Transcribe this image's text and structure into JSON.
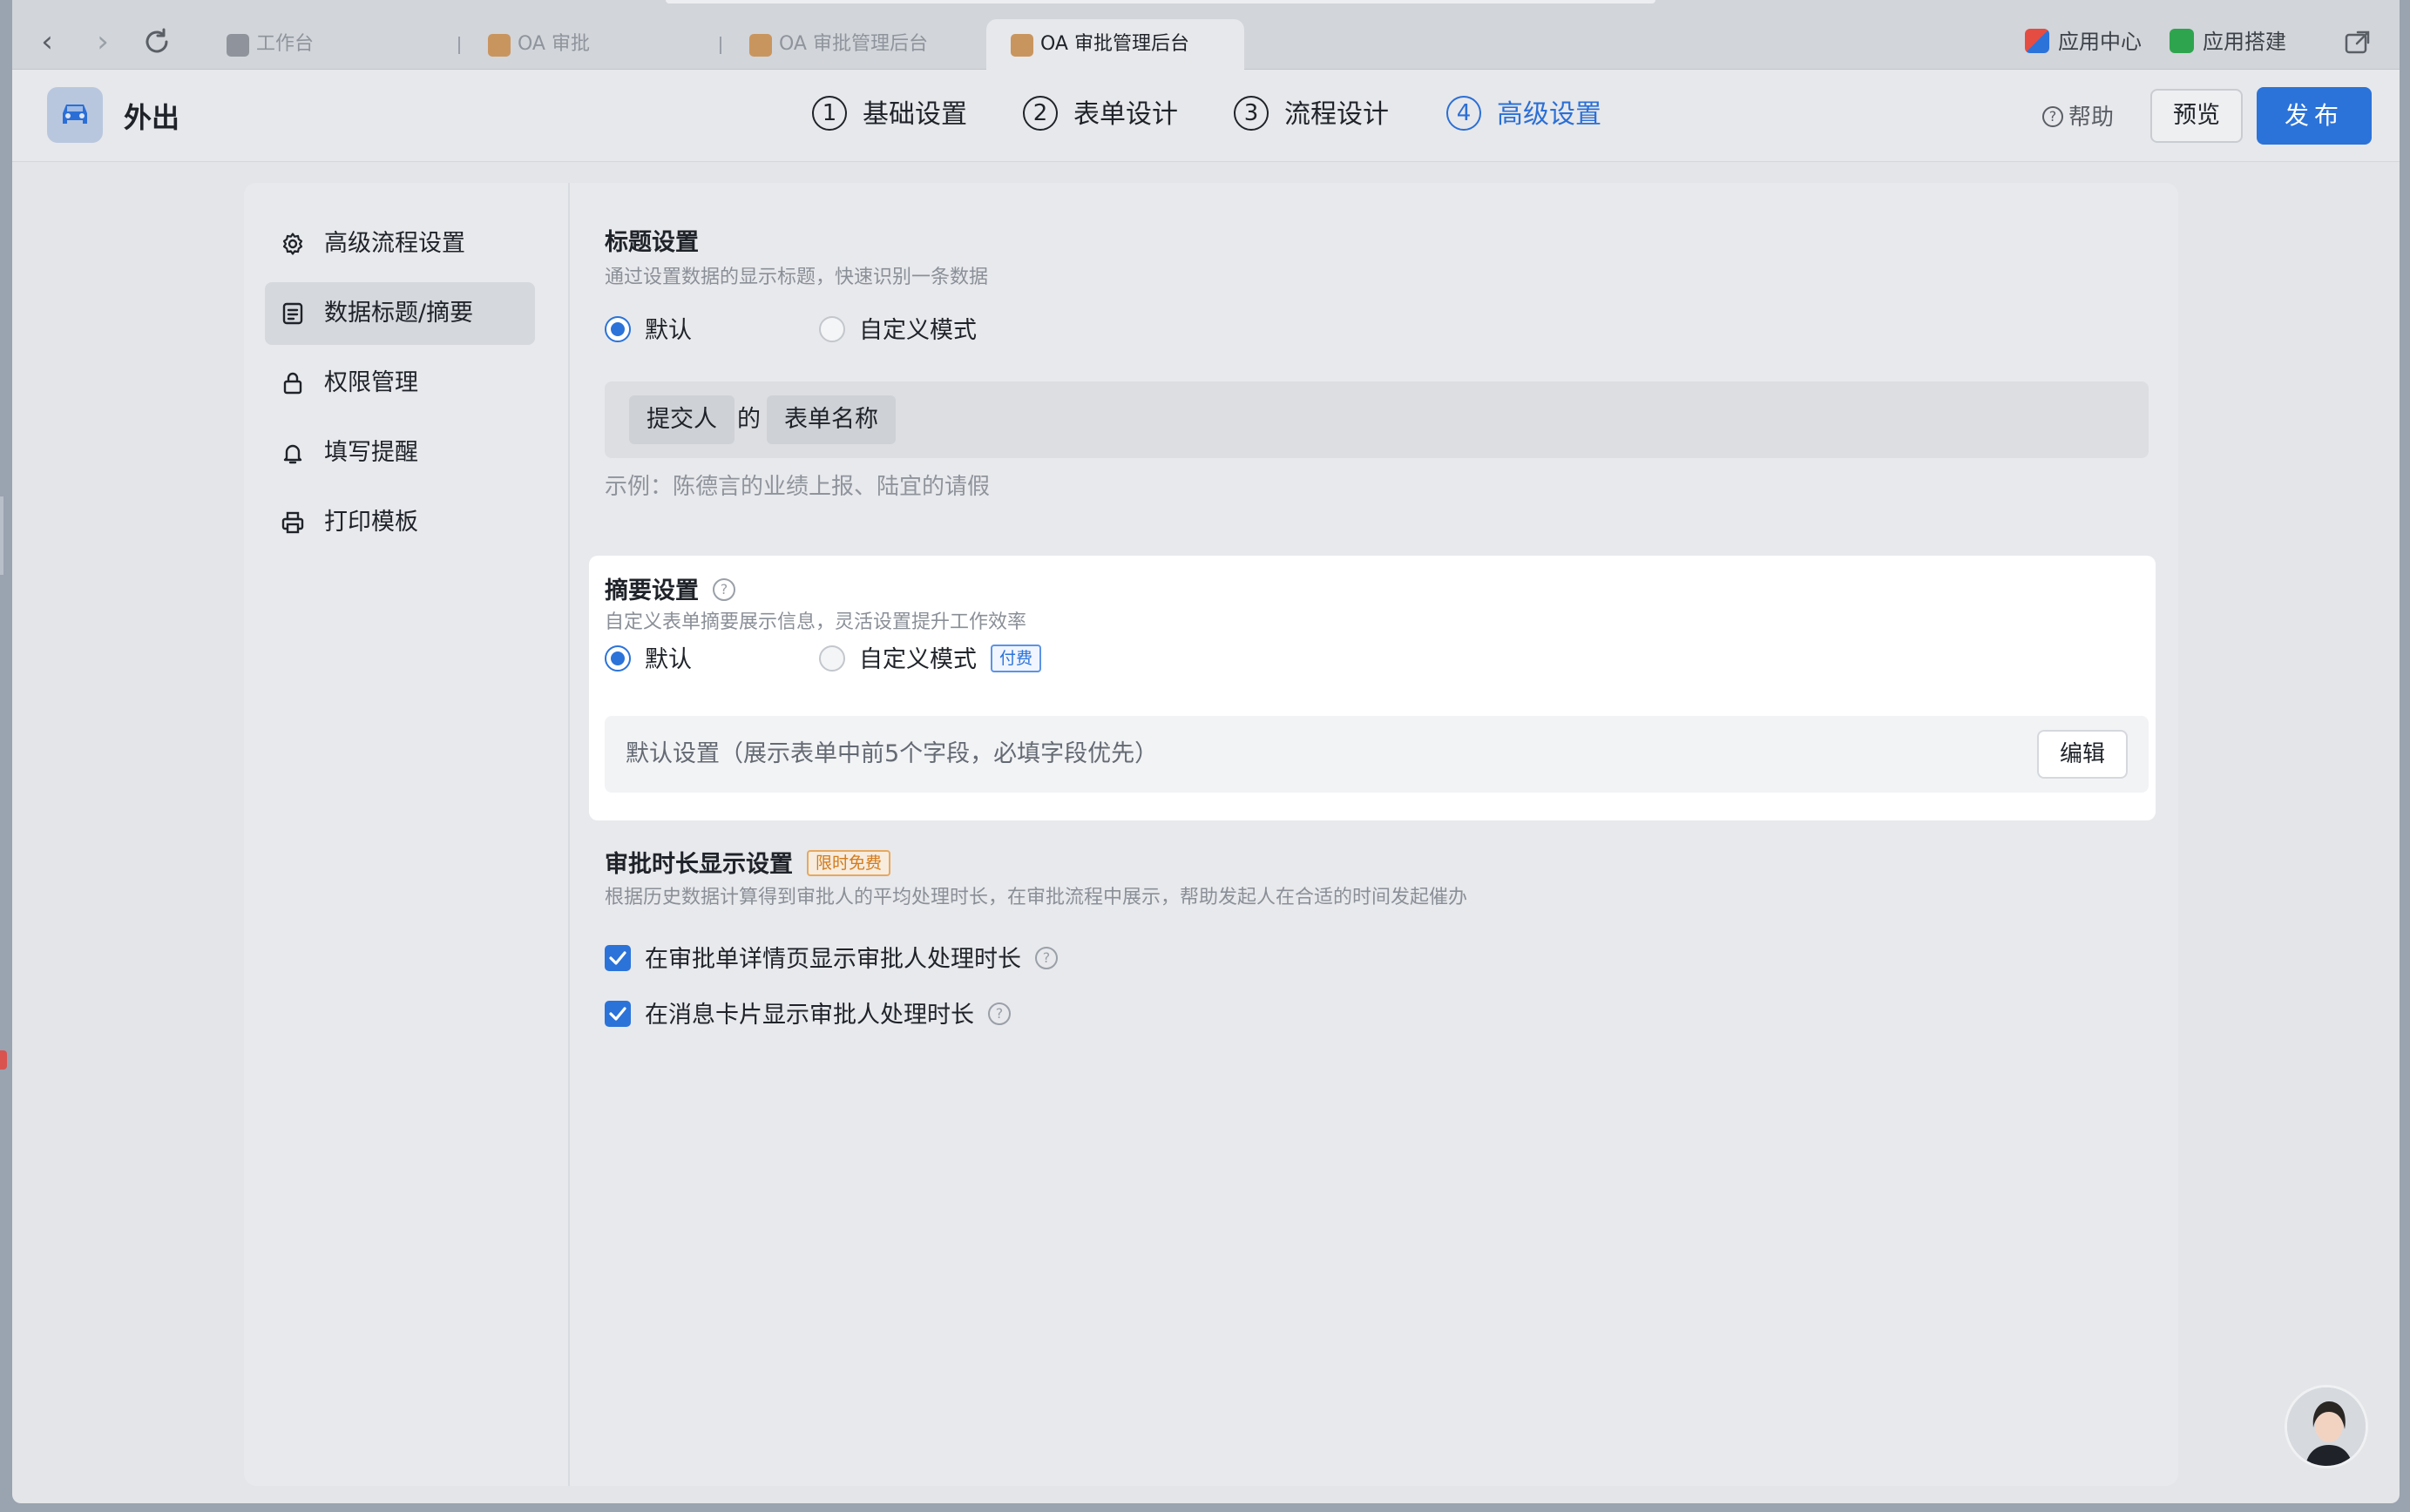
{
  "browser": {
    "tabs": [
      {
        "label": "工作台"
      },
      {
        "label": "OA 审批"
      },
      {
        "label": "OA 审批管理后台"
      },
      {
        "label": "OA 审批管理后台"
      }
    ],
    "app_center": "应用中心",
    "app_builder": "应用搭建"
  },
  "header": {
    "app_name": "外出",
    "steps": [
      {
        "num": "1",
        "label": "基础设置"
      },
      {
        "num": "2",
        "label": "表单设计"
      },
      {
        "num": "3",
        "label": "流程设计"
      },
      {
        "num": "4",
        "label": "高级设置"
      }
    ],
    "help": "帮助",
    "preview": "预览",
    "publish": "发布"
  },
  "sidebar": {
    "items": [
      {
        "label": "高级流程设置"
      },
      {
        "label": "数据标题/摘要"
      },
      {
        "label": "权限管理"
      },
      {
        "label": "填写提醒"
      },
      {
        "label": "打印模板"
      }
    ]
  },
  "title_settings": {
    "title": "标题设置",
    "desc": "通过设置数据的显示标题，快速识别一条数据",
    "option_default": "默认",
    "option_custom": "自定义模式",
    "chip_submitter": "提交人",
    "connector": "的",
    "chip_form_name": "表单名称",
    "example": "示例：陈德言的业绩上报、陆宜的请假"
  },
  "summary_settings": {
    "title": "摘要设置",
    "desc": "自定义表单摘要展示信息，灵活设置提升工作效率",
    "option_default": "默认",
    "option_custom": "自定义模式",
    "paid_tag": "付费",
    "default_text": "默认设置（展示表单中前5个字段，必填字段优先）",
    "edit": "编辑"
  },
  "duration_settings": {
    "title": "审批时长显示设置",
    "free_tag": "限时免费",
    "desc": "根据历史数据计算得到审批人的平均处理时长，在审批流程中展示，帮助发起人在合适的时间发起催办",
    "check1": "在审批单详情页显示审批人处理时长",
    "check2": "在消息卡片显示审批人处理时长"
  },
  "colors": {
    "accent": "#2b73d9",
    "free_tag": "#d37a1c"
  }
}
